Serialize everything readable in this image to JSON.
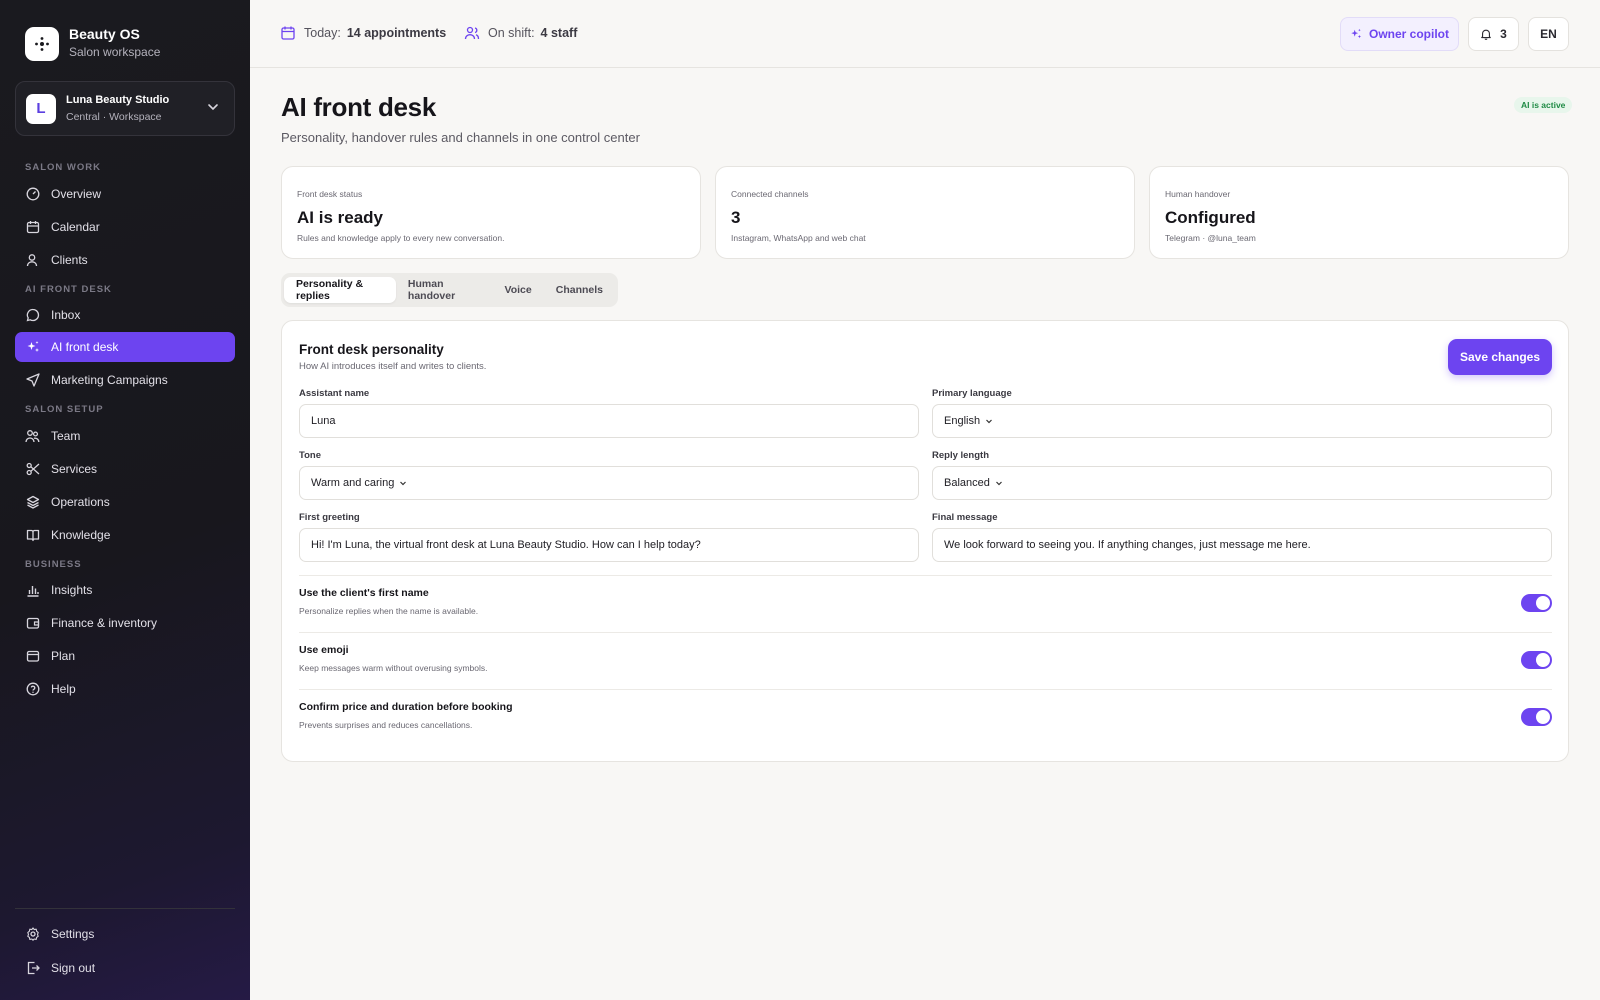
{
  "brand": {
    "title": "Beauty OS",
    "subtitle": "Salon workspace"
  },
  "workspace": {
    "initial": "L",
    "name": "Luna Beauty Studio",
    "sub": "Central · Workspace"
  },
  "nav": {
    "sections": {
      "salon_work": "SALON WORK",
      "ai_front_desk": "AI FRONT DESK",
      "salon_setup": "SALON SETUP",
      "business": "BUSINESS"
    },
    "items": {
      "overview": "Overview",
      "calendar": "Calendar",
      "clients": "Clients",
      "inbox": "Inbox",
      "ai_front_desk": "AI front desk",
      "marketing": "Marketing Campaigns",
      "team": "Team",
      "services": "Services",
      "operations": "Operations",
      "knowledge": "Knowledge",
      "insights": "Insights",
      "finance": "Finance & inventory",
      "plan": "Plan",
      "help": "Help",
      "settings": "Settings",
      "signout": "Sign out"
    },
    "active": "ai_front_desk"
  },
  "topbar": {
    "today_label": "Today:",
    "today_value": "14 appointments",
    "shift_label": "On shift:",
    "shift_value": "4 staff",
    "copilot": "Owner copilot",
    "notifications": "3",
    "language": "EN"
  },
  "page": {
    "title": "AI front desk",
    "subtitle": "Personality, handover rules and channels in one control center",
    "badge": "AI is active"
  },
  "stats": [
    {
      "label": "Front desk status",
      "value": "AI is ready",
      "note": "Rules and knowledge apply to every new conversation."
    },
    {
      "label": "Connected channels",
      "value": "3",
      "note": "Instagram, WhatsApp and web chat"
    },
    {
      "label": "Human handover",
      "value": "Configured",
      "note": "Telegram · @luna_team"
    }
  ],
  "tabs": [
    "Personality & replies",
    "Human handover",
    "Voice",
    "Channels"
  ],
  "panel": {
    "title": "Front desk personality",
    "subtitle": "How AI introduces itself and writes to clients.",
    "save": "Save changes",
    "fields": {
      "assistant_name": {
        "label": "Assistant name",
        "value": "Luna"
      },
      "primary_language": {
        "label": "Primary language",
        "value": "English"
      },
      "tone": {
        "label": "Tone",
        "value": "Warm and caring"
      },
      "reply_length": {
        "label": "Reply length",
        "value": "Balanced"
      },
      "first_greeting": {
        "label": "First greeting",
        "value": "Hi! I'm Luna, the virtual front desk at Luna Beauty Studio. How can I help today?"
      },
      "final_message": {
        "label": "Final message",
        "value": "We look forward to seeing you. If anything changes, just message me here."
      }
    },
    "toggles": [
      {
        "title": "Use the client's first name",
        "sub": "Personalize replies when the name is available.",
        "on": true
      },
      {
        "title": "Use emoji",
        "sub": "Keep messages warm without overusing symbols.",
        "on": true
      },
      {
        "title": "Confirm price and duration before booking",
        "sub": "Prevents surprises and reduces cancellations.",
        "on": true
      }
    ]
  },
  "colors": {
    "accent": "#6d44f0",
    "sidebar": "#1a1a1f",
    "success": "#1e8a44"
  }
}
